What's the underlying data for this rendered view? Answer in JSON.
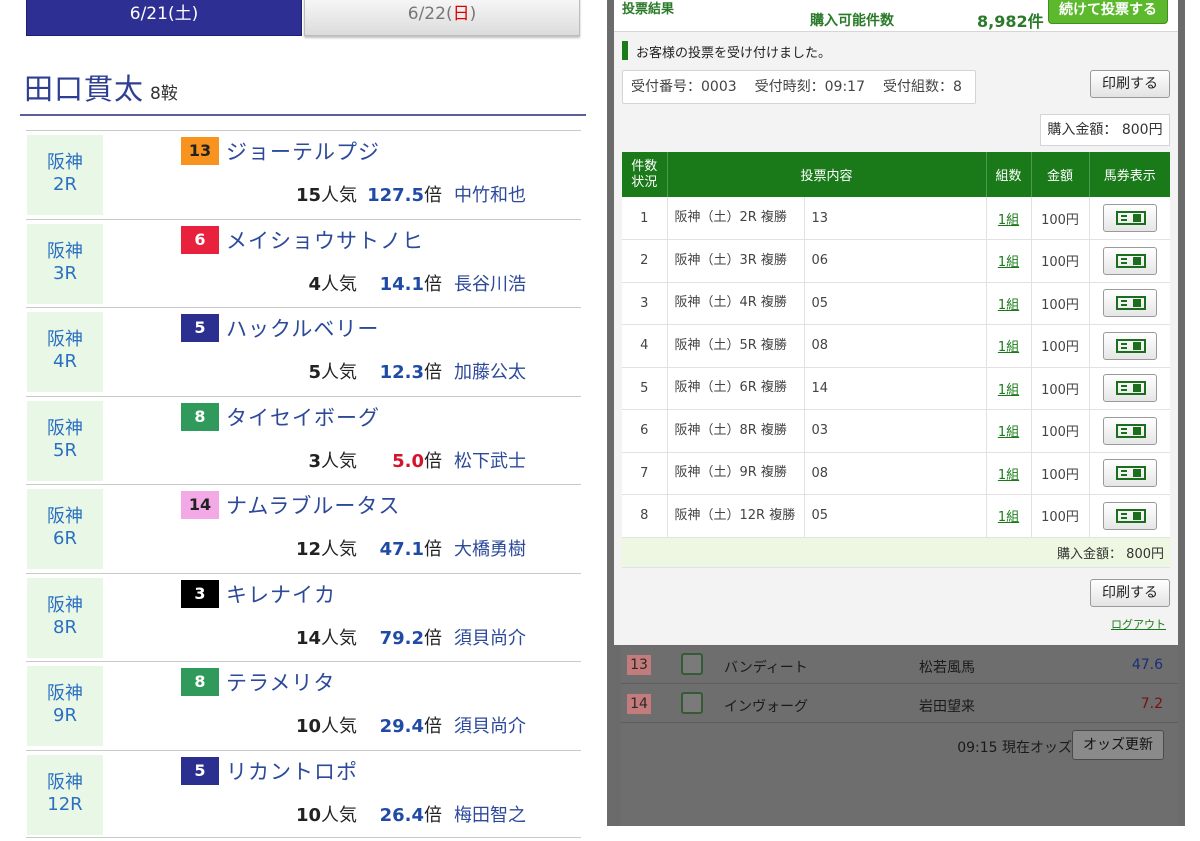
{
  "left": {
    "tabs": [
      {
        "label": "6/21(",
        "weekday": "土",
        "suffix": ")"
      },
      {
        "label": "6/22(",
        "weekday": "日",
        "suffix": ")"
      }
    ],
    "jockey_name": "田口貫太",
    "mount_count": "8鞍",
    "races": [
      {
        "venue": "阪神",
        "race": "2R",
        "num": "13",
        "num_bg": "#f7931e",
        "num_fg": "#222222",
        "horse": "ジョーテルプジ",
        "pop": "15",
        "pop_unit": "人気",
        "odds": "127.5",
        "odds_unit": "倍",
        "jockey": "中竹和也",
        "hot": false
      },
      {
        "venue": "阪神",
        "race": "3R",
        "num": "6",
        "num_bg": "#e8213c",
        "num_fg": "#ffffff",
        "horse": "メイショウサトノヒ",
        "pop": "4",
        "pop_unit": "人気",
        "odds": "14.1",
        "odds_unit": "倍",
        "jockey": "長谷川浩",
        "hot": false
      },
      {
        "venue": "阪神",
        "race": "4R",
        "num": "5",
        "num_bg": "#2b2f8f",
        "num_fg": "#ffffff",
        "horse": "ハックルベリー",
        "pop": "5",
        "pop_unit": "人気",
        "odds": "12.3",
        "odds_unit": "倍",
        "jockey": "加藤公太",
        "hot": false
      },
      {
        "venue": "阪神",
        "race": "5R",
        "num": "8",
        "num_bg": "#2f9a5b",
        "num_fg": "#ffffff",
        "horse": "タイセイボーグ",
        "pop": "3",
        "pop_unit": "人気",
        "odds": "5.0",
        "odds_unit": "倍",
        "jockey": "松下武士",
        "hot": true
      },
      {
        "venue": "阪神",
        "race": "6R",
        "num": "14",
        "num_bg": "#f2a9e6",
        "num_fg": "#222222",
        "horse": "ナムラブルータス",
        "pop": "12",
        "pop_unit": "人気",
        "odds": "47.1",
        "odds_unit": "倍",
        "jockey": "大橋勇樹",
        "hot": false
      },
      {
        "venue": "阪神",
        "race": "8R",
        "num": "3",
        "num_bg": "#000000",
        "num_fg": "#ffffff",
        "horse": "キレナイカ",
        "pop": "14",
        "pop_unit": "人気",
        "odds": "79.2",
        "odds_unit": "倍",
        "jockey": "須貝尚介",
        "hot": false
      },
      {
        "venue": "阪神",
        "race": "9R",
        "num": "8",
        "num_bg": "#2f9a5b",
        "num_fg": "#ffffff",
        "horse": "テラメリタ",
        "pop": "10",
        "pop_unit": "人気",
        "odds": "29.4",
        "odds_unit": "倍",
        "jockey": "須貝尚介",
        "hot": false
      },
      {
        "venue": "阪神",
        "race": "12R",
        "num": "5",
        "num_bg": "#2b2f8f",
        "num_fg": "#ffffff",
        "horse": "リカントロポ",
        "pop": "10",
        "pop_unit": "人気",
        "odds": "26.4",
        "odds_unit": "倍",
        "jockey": "梅田智之",
        "hot": false
      }
    ]
  },
  "right": {
    "top": {
      "result_label": "投票結果",
      "purchasable_label": "購入可能件数",
      "purchasable_count": "8,982件",
      "continue_button": "続けて投票する"
    },
    "notice": "お客様の投票を受け付けました。",
    "receipt": {
      "number": "受付番号：0003",
      "time": "受付時刻：09:17",
      "sets": "受付組数：8"
    },
    "print_button": "印刷する",
    "purchase_total": "購入金額： 800円",
    "table": {
      "headers": {
        "idx": "件数\n状況",
        "content": "投票内容",
        "kumi": "組数",
        "amount": "金額",
        "ticket": "馬券表示"
      },
      "rows": [
        {
          "idx": "1",
          "race": "阪神（土）2R 複勝",
          "sel": "13",
          "kumi": "1組",
          "amount": "100円"
        },
        {
          "idx": "2",
          "race": "阪神（土）3R 複勝",
          "sel": "06",
          "kumi": "1組",
          "amount": "100円"
        },
        {
          "idx": "3",
          "race": "阪神（土）4R 複勝",
          "sel": "05",
          "kumi": "1組",
          "amount": "100円"
        },
        {
          "idx": "4",
          "race": "阪神（土）5R 複勝",
          "sel": "08",
          "kumi": "1組",
          "amount": "100円"
        },
        {
          "idx": "5",
          "race": "阪神（土）6R 複勝",
          "sel": "14",
          "kumi": "1組",
          "amount": "100円"
        },
        {
          "idx": "6",
          "race": "阪神（土）8R 複勝",
          "sel": "03",
          "kumi": "1組",
          "amount": "100円"
        },
        {
          "idx": "7",
          "race": "阪神（土）9R 複勝",
          "sel": "08",
          "kumi": "1組",
          "amount": "100円"
        },
        {
          "idx": "8",
          "race": "阪神（土）12R 複勝",
          "sel": "05",
          "kumi": "1組",
          "amount": "100円"
        }
      ],
      "footer_total": "購入金額： 800円"
    },
    "logout": "ログアウト",
    "background_odds": {
      "rows": [
        {
          "num": "13",
          "name": "バンディート",
          "jockey": "松若風馬",
          "odds": "47.6",
          "odds_color": "blue"
        },
        {
          "num": "14",
          "name": "インヴォーグ",
          "jockey": "岩田望来",
          "odds": "7.2",
          "odds_color": "red"
        }
      ],
      "time_label": "09:15 現在オッズ",
      "refresh_button": "オッズ更新"
    }
  }
}
